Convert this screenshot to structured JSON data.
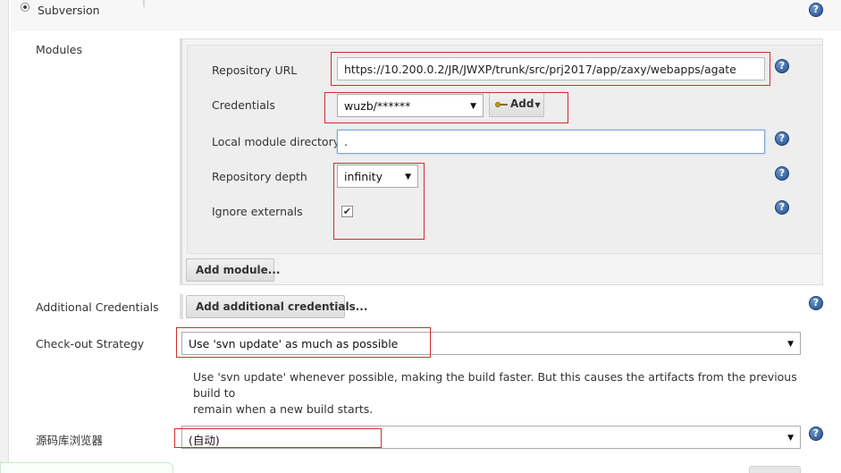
{
  "section": {
    "title": "Subversion"
  },
  "modules": {
    "label": "Modules",
    "repository_url": {
      "label": "Repository URL",
      "value": "https://10.200.0.2/JR/JWXP/trunk/src/prj2017/app/zaxy/webapps/agate"
    },
    "credentials": {
      "label": "Credentials",
      "selected": "wuzb/******",
      "add_label": "Add"
    },
    "local_module_directory": {
      "label": "Local module directory",
      "value": "."
    },
    "repository_depth": {
      "label": "Repository depth",
      "selected": "infinity"
    },
    "ignore_externals": {
      "label": "Ignore externals",
      "checked": true
    },
    "add_module_label": "Add module..."
  },
  "additional_credentials": {
    "label": "Additional Credentials",
    "button_label": "Add additional credentials..."
  },
  "checkout_strategy": {
    "label": "Check-out Strategy",
    "selected": "Use 'svn update' as much as possible",
    "description_line1": "Use 'svn update' whenever possible, making the build faster. But this causes the artifacts from the previous build to",
    "description_line2": "remain when a new build starts."
  },
  "repository_browser": {
    "label": "源码库浏览器",
    "selected": "(自动)"
  },
  "icons": {
    "help": "?",
    "dropdown": "▼",
    "check": "✔"
  },
  "colors": {
    "highlight_box": "#d52b2b",
    "help_icon": "#1f4f8f",
    "focus_border": "#7fa6d6"
  }
}
